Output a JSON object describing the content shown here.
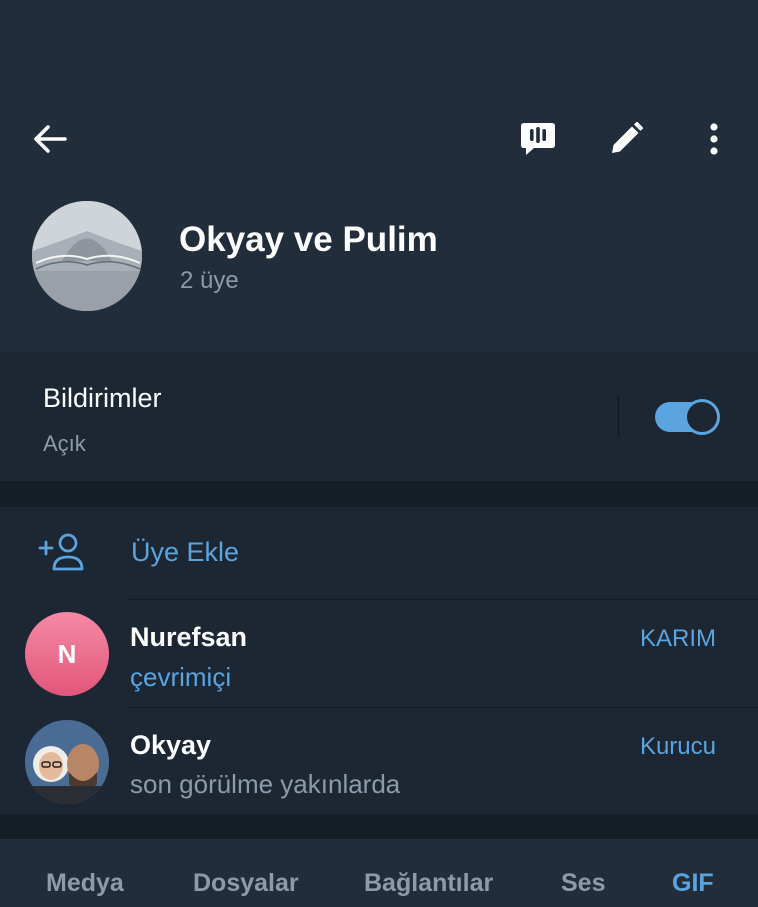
{
  "header": {
    "title": "Okyay ve Pulim",
    "subtitle": "2 üye"
  },
  "notifications": {
    "label": "Bildirimler",
    "value": "Açık",
    "enabled": true
  },
  "members": {
    "add_label": "Üye Ekle",
    "items": [
      {
        "initial": "N",
        "name": "Nurefsan",
        "status": "çevrimiçi",
        "role": "KARIM"
      },
      {
        "name": "Okyay",
        "status": "son görülme yakınlarda",
        "role": "Kurucu"
      }
    ]
  },
  "tabs": [
    "Medya",
    "Dosyalar",
    "Bağlantılar",
    "Ses",
    "GIF"
  ],
  "active_tab": "GIF",
  "colors": {
    "accent": "#5aa4df",
    "header_bg": "#212d3b",
    "body_bg": "#1d2733",
    "secondary_text": "#8d9ba8"
  }
}
